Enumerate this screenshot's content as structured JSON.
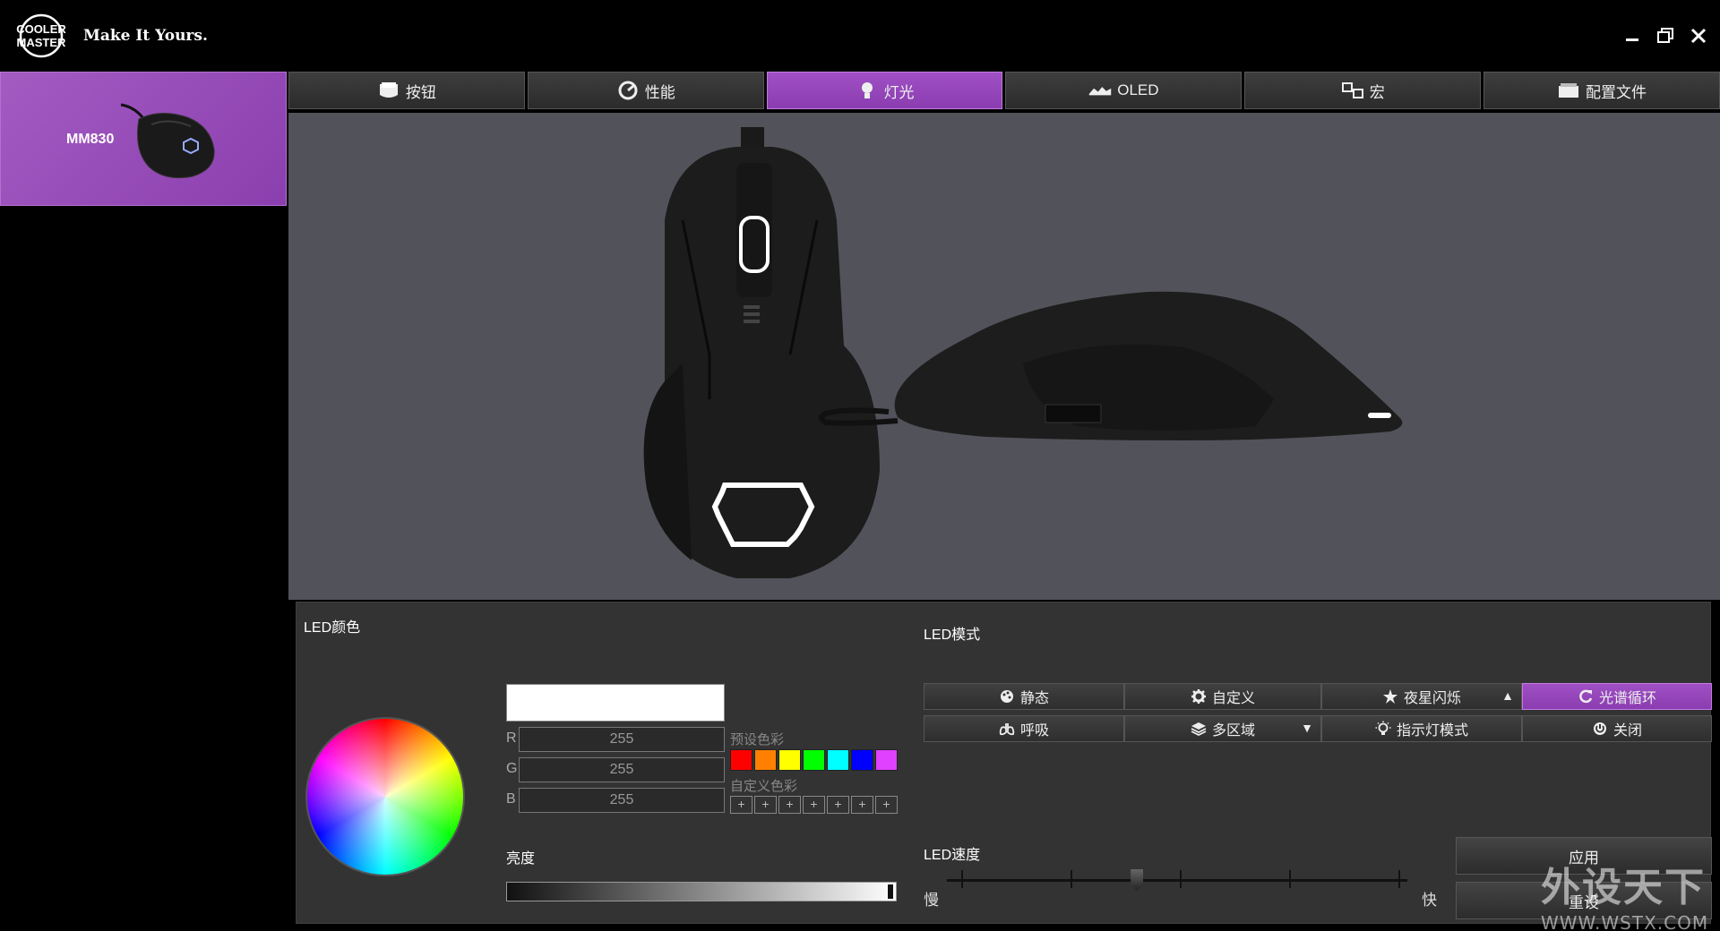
{
  "titlebar": {
    "brand": "COOLER MASTER",
    "tagline": "Make It Yours.",
    "minimize_icon": "minimize-icon",
    "maximize_icon": "restore-icon",
    "close_icon": "close-icon"
  },
  "device": {
    "name": "MM830"
  },
  "tabs": [
    {
      "label": "按钮",
      "icon": "mouse-button-icon"
    },
    {
      "label": "性能",
      "icon": "gauge-icon"
    },
    {
      "label": "灯光",
      "icon": "bulb-icon",
      "active": true
    },
    {
      "label": "OLED",
      "icon": "oled-icon"
    },
    {
      "label": "宏",
      "icon": "macro-icon"
    },
    {
      "label": "配置文件",
      "icon": "folder-icon"
    }
  ],
  "led_color": {
    "label": "LED颜色",
    "current_color": "#ffffff",
    "r": "255",
    "g": "255",
    "b": "255",
    "r_label": "R",
    "g_label": "G",
    "b_label": "B",
    "preset_label": "预设色彩",
    "presets": [
      "#ff0000",
      "#ff8000",
      "#ffff00",
      "#00ff00",
      "#00ffff",
      "#0000ff",
      "#e040ff"
    ],
    "custom_label": "自定义色彩",
    "custom_slot": "+",
    "brightness_label": "亮度",
    "brightness": 1.0
  },
  "led_mode": {
    "label": "LED模式",
    "modes": [
      {
        "label": "静态",
        "icon": "palette-icon"
      },
      {
        "label": "自定义",
        "icon": "gear-icon"
      },
      {
        "label": "夜星闪烁",
        "icon": "star-icon",
        "arrow": "▲"
      },
      {
        "label": "光谱循环",
        "icon": "refresh-icon",
        "active": true
      },
      {
        "label": "呼吸",
        "icon": "lungs-icon"
      },
      {
        "label": "多区域",
        "icon": "layers-icon",
        "arrow": "▼"
      },
      {
        "label": "指示灯模式",
        "icon": "lightbulb-icon"
      },
      {
        "label": "关闭",
        "icon": "power-icon"
      }
    ]
  },
  "led_speed": {
    "label": "LED速度",
    "slow": "慢",
    "fast": "快",
    "value": 0.4
  },
  "actions": {
    "apply": "应用",
    "reset": "重设"
  },
  "watermark": {
    "line1": "外设天下",
    "line2": "WWW.WSTX.COM"
  }
}
